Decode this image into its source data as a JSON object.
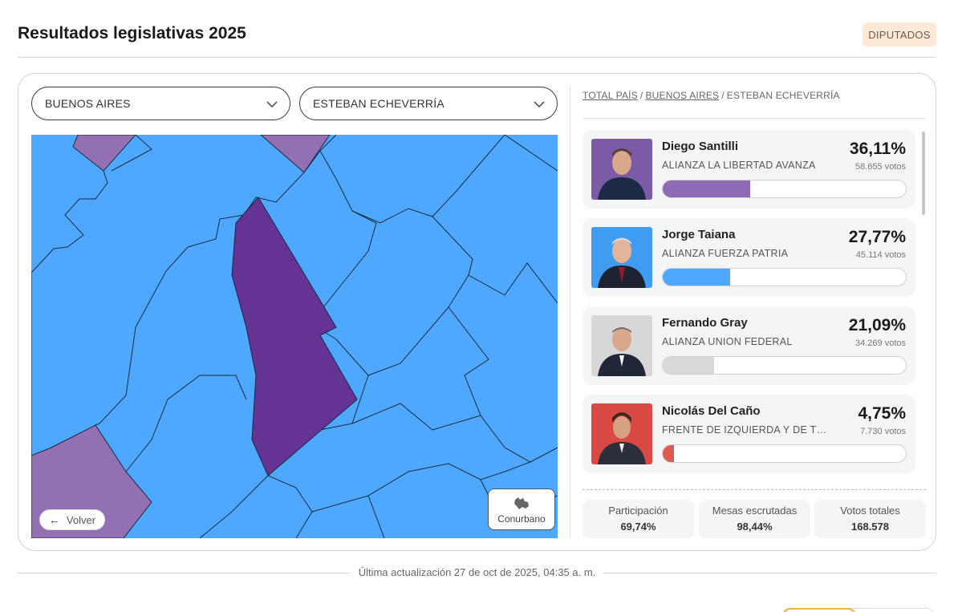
{
  "header": {
    "title": "Resultados legislativas 2025",
    "chamber_badge": "DIPUTADOS"
  },
  "filters": {
    "province": "BUENOS AIRES",
    "district": "ESTEBAN ECHEVERRÍA"
  },
  "map": {
    "back_label": "Volver",
    "conurbano_label": "Conurbano",
    "colors": {
      "libertad_avanza_light": "#9370b4",
      "libertad_avanza_dark": "#653393",
      "fuerza_patria": "#4ea8ff",
      "border": "#1a2a3a"
    }
  },
  "breadcrumb": {
    "items": [
      "TOTAL PAÍS",
      "BUENOS AIRES",
      "ESTEBAN ECHEVERRÍA"
    ],
    "separator": "/"
  },
  "candidates": [
    {
      "name": "Diego Santilli",
      "party": "ALIANZA LA LIBERTAD AVANZA",
      "percent_label": "36,11%",
      "percent": 36.11,
      "votes": "58.655 votos",
      "color": "#8f6bb5",
      "photo_bg": "#7b5aa6"
    },
    {
      "name": "Jorge Taiana",
      "party": "ALIANZA FUERZA PATRIA",
      "percent_label": "27,77%",
      "percent": 27.77,
      "votes": "45.114 votos",
      "color": "#4ea8ff",
      "photo_bg": "#3f9cf0"
    },
    {
      "name": "Fernando Gray",
      "party": "ALIANZA UNION FEDERAL",
      "percent_label": "21,09%",
      "percent": 21.09,
      "votes": "34.269 votos",
      "color": "#d9d9d9",
      "photo_bg": "#d7d7d7"
    },
    {
      "name": "Nicolás Del Caño",
      "party": "FRENTE DE IZQUIERDA Y DE TRABAJADORES - UNIDAD",
      "percent_label": "4,75%",
      "percent": 4.75,
      "votes": "7.730 votos",
      "color": "#e05a52",
      "photo_bg": "#d94a44"
    }
  ],
  "stats": [
    {
      "label": "Participación",
      "value": "69,74%"
    },
    {
      "label": "Mesas escrutadas",
      "value": "98,44%"
    },
    {
      "label": "Votos totales",
      "value": "168.578"
    }
  ],
  "footer": {
    "last_update": "Última actualización 27 de oct de 2025, 04:35 a. m."
  }
}
